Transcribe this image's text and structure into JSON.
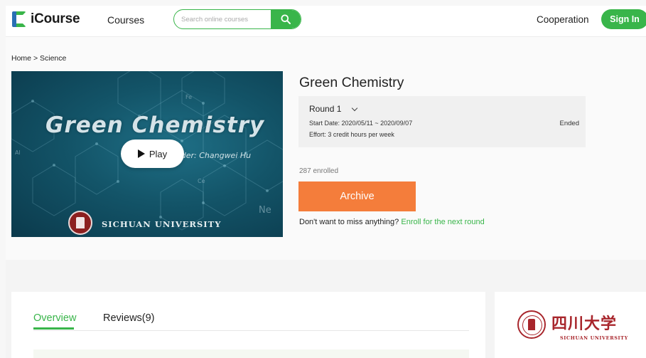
{
  "header": {
    "logo_text": "iCourse",
    "nav_courses": "Courses",
    "search_placeholder": "Search online courses",
    "search_icon": "search-icon",
    "cooperation": "Cooperation",
    "sign_in": "Sign In"
  },
  "breadcrumb": {
    "home": "Home",
    "separator": ">",
    "current": "Science"
  },
  "video": {
    "title": "Green Chemistry",
    "leader": "ader: Changwei Hu",
    "university": "SICHUAN UNIVERSITY",
    "play_label": "Play",
    "element_tags": [
      "Fe",
      "Al",
      "Ce",
      "Ne"
    ]
  },
  "course": {
    "title": "Green Chemistry",
    "round": "Round 1",
    "dates": "Start Date: 2020/05/11 ~ 2020/09/07",
    "effort": "Effort: 3 credit hours per week",
    "status": "Ended",
    "enrolled": "287 enrolled",
    "archive_label": "Archive",
    "next_round_prefix": "Don't want to miss anything?",
    "next_round_link": "Enroll for the next round"
  },
  "tabs": [
    {
      "label": "Overview",
      "active": true
    },
    {
      "label": "Reviews(9)",
      "active": false
    }
  ],
  "university_card": {
    "name_cn": "四川大学",
    "name_en": "SICHUAN UNIVERSITY"
  },
  "colors": {
    "accent_green": "#39b54a",
    "archive_orange": "#f47d3b",
    "logo_blue": "#2a6fb5",
    "university_red": "#a8262c"
  }
}
